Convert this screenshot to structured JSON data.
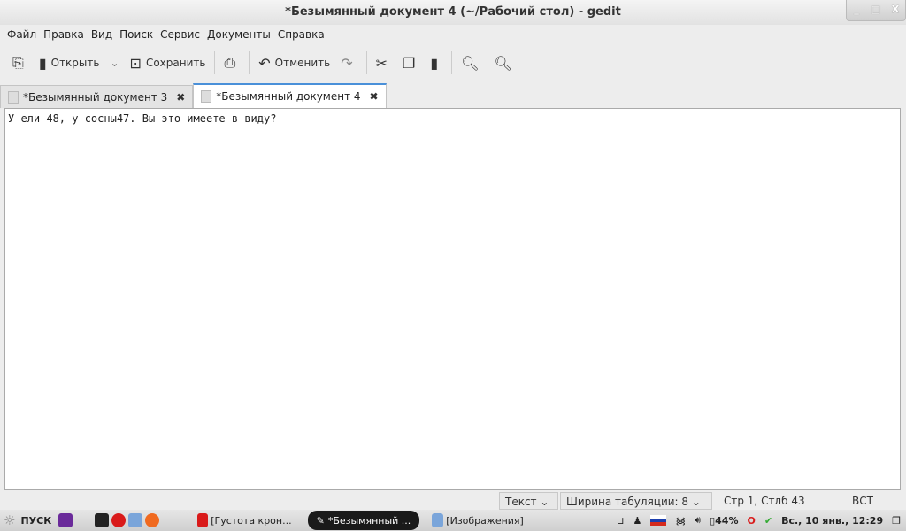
{
  "window": {
    "title": "*Безымянный документ 4 (~/Рабочий стол) - gedit",
    "minimize": "_",
    "maximize": "□",
    "close": "X"
  },
  "menu": [
    "Файл",
    "Правка",
    "Вид",
    "Поиск",
    "Сервис",
    "Документы",
    "Справка"
  ],
  "toolbar": {
    "open": "Открыть",
    "save": "Сохранить",
    "undo": "Отменить"
  },
  "tabs": [
    {
      "label": "*Безымянный документ 3"
    },
    {
      "label": "*Безымянный документ 4"
    }
  ],
  "editor": {
    "text": "У ели 48, у сосны47. Вы это имеете в виду?"
  },
  "status": {
    "lang": "Текст",
    "tab_width": "Ширина табуляции:  8",
    "position": "Стр 1, Стлб 43",
    "mode": "ВСТ"
  },
  "taskbar": {
    "start": "ПУСК",
    "tasks": [
      "[Густота крон...",
      "*Безымянный ...",
      "[Изображения]"
    ],
    "battery": "44%",
    "clock": "Вс., 10 янв., 12:29"
  }
}
